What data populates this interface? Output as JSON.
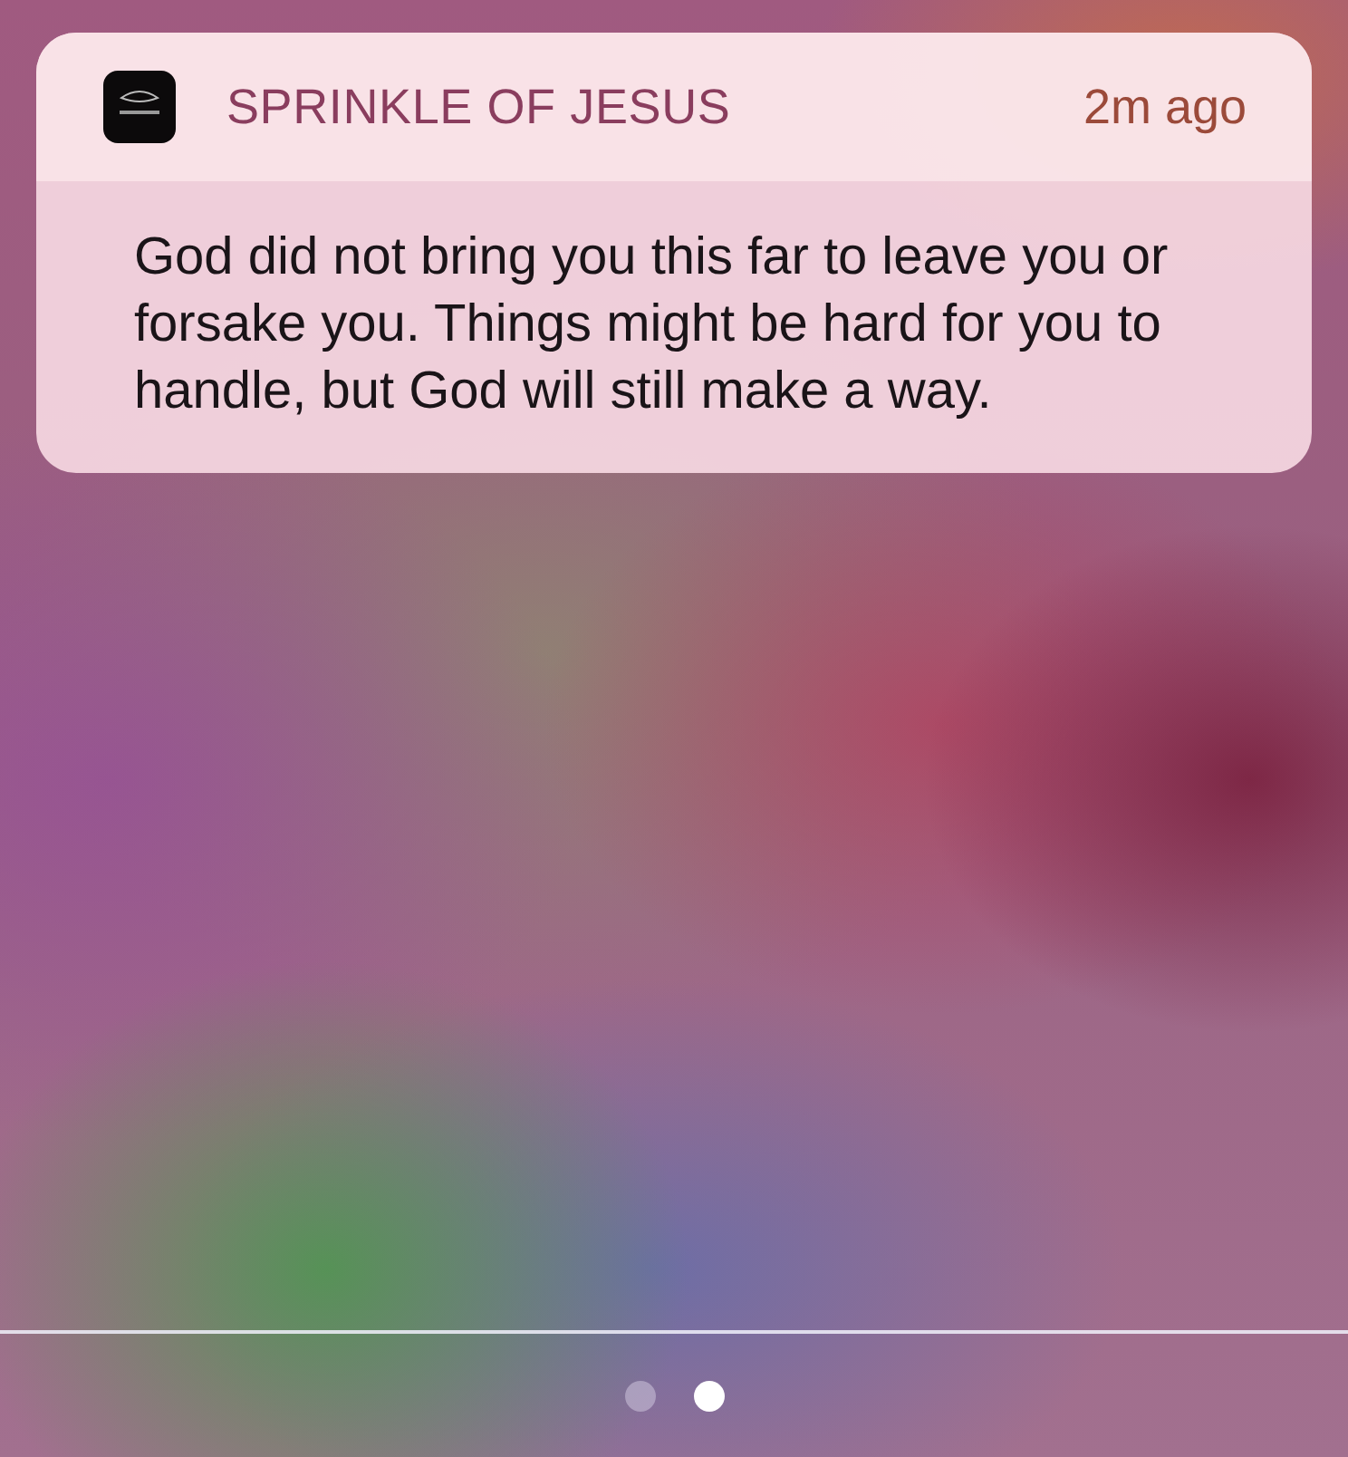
{
  "notification": {
    "app_name": "SPRINKLE OF JESUS",
    "time": "2m ago",
    "message": "God did not bring you this far to leave you or forsake you. Things might be hard for you to handle, but God will still make a way."
  },
  "page_dots": [
    {
      "selected": false
    },
    {
      "selected": true
    }
  ]
}
